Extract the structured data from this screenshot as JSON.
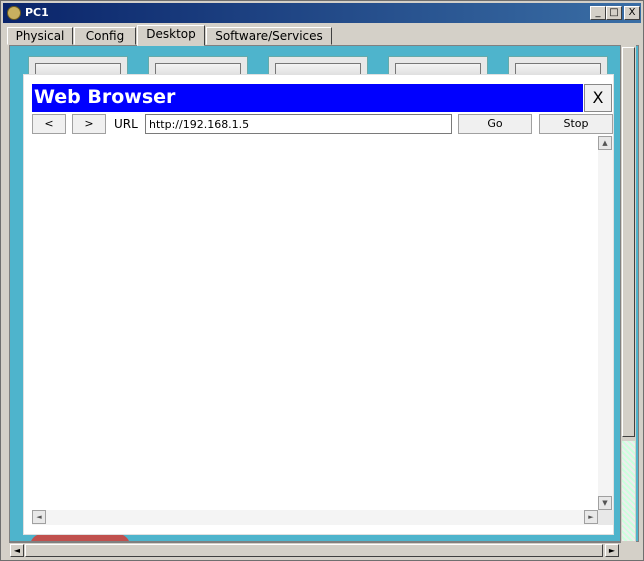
{
  "window": {
    "title": "PC1",
    "minimize_glyph": "_",
    "maximize_glyph": "□",
    "close_glyph": "X"
  },
  "tabs": [
    {
      "label": "Physical"
    },
    {
      "label": "Config"
    },
    {
      "label": "Desktop",
      "active": true
    },
    {
      "label": "Software/Services"
    }
  ],
  "browser": {
    "title": "Web Browser",
    "close_label": "X",
    "back_label": "<",
    "forward_label": ">",
    "url_label": "URL",
    "url_value": "http://192.168.1.5",
    "go_label": "Go",
    "stop_label": "Stop"
  },
  "scroll": {
    "up": "▲",
    "down": "▼",
    "left": "◄",
    "right": "►"
  },
  "colors": {
    "browser_title_bg": "#0000ff",
    "desktop_bg": "#4eb4cc"
  }
}
